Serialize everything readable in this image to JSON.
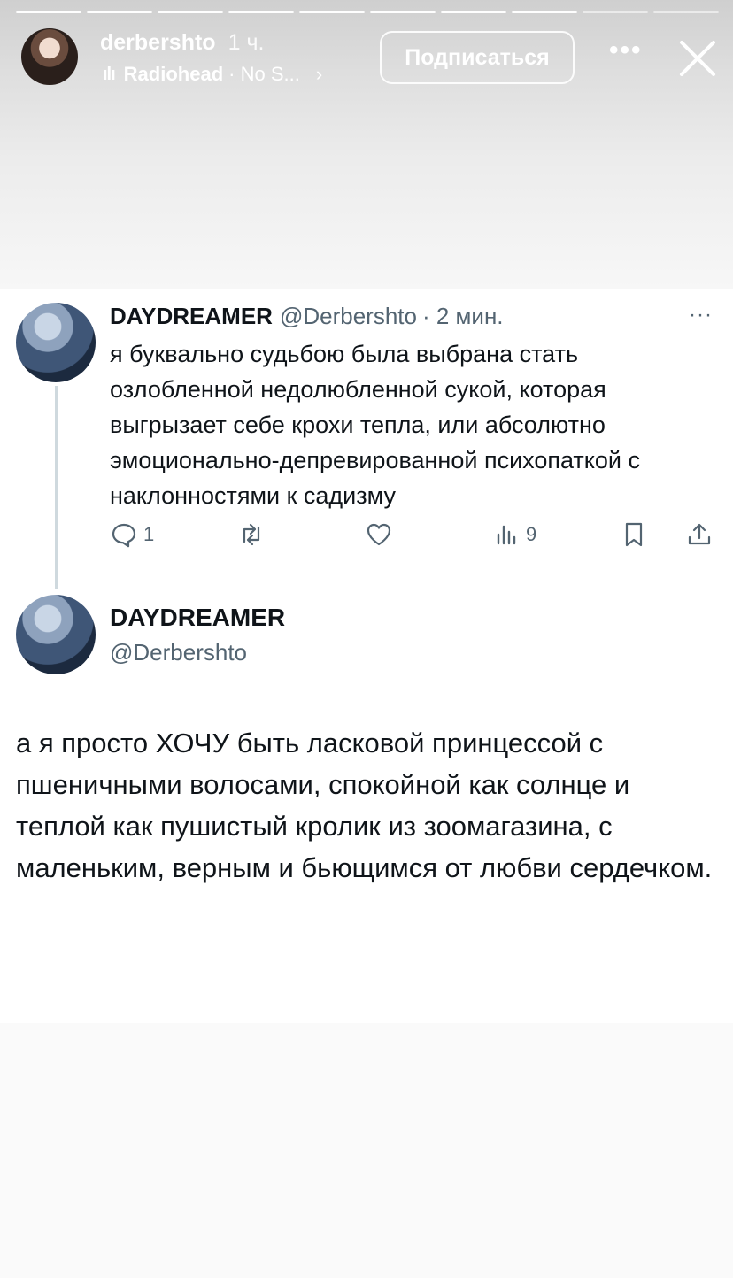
{
  "story": {
    "username": "derbershto",
    "time": "1 ч.",
    "music": {
      "artist": "Radiohead",
      "song": "· No S...",
      "chevron": "›"
    },
    "follow_label": "Подписаться",
    "more_label": "•••",
    "progress_segments_total": 10,
    "progress_segments_done": 8,
    "icons": [
      "music-bars-icon",
      "chevron-right-icon",
      "more-icon",
      "close-icon"
    ]
  },
  "tweet1": {
    "name": "DAYDREAMER",
    "handle": "@Derbershto",
    "time": "· 2 мин.",
    "more": "···",
    "text": "я буквально судьбою была выбрана стать озлобленной недолюбленной сукой, которая выгрызает себе крохи тепла, или абсолютно эмоционально-депревированной психопаткой с наклонностями к садизму",
    "actions": {
      "reply_count": "1",
      "retweet_count": "",
      "like_count": "",
      "views_count": "9"
    }
  },
  "tweet2": {
    "name": "DAYDREAMER",
    "handle": "@Derbershto",
    "text": "а я просто ХОЧУ быть ласковой принцессой с пшеничными волосами, спокойной как солнце и теплой как пушистый кролик из зоомагазина, с маленьким, верным и бьющимся от любви сердечком."
  },
  "colors": {
    "text": "#0f1419",
    "secondary": "#536471",
    "thread_line": "#cfd9de"
  }
}
